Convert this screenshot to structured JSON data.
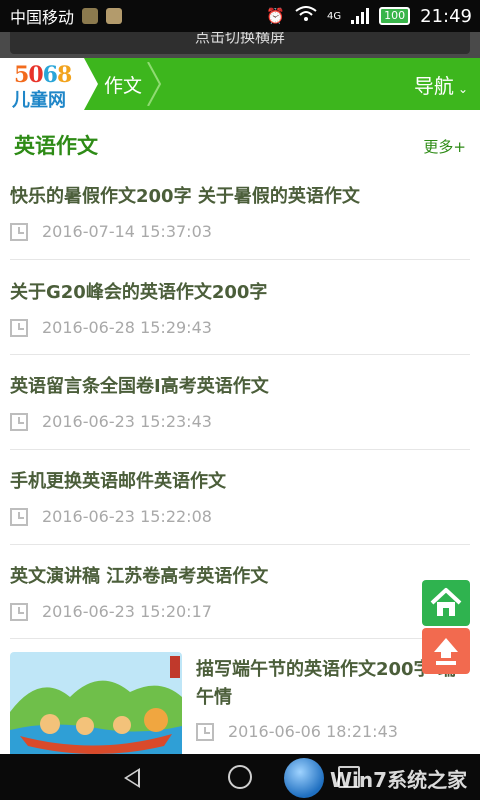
{
  "status_bar": {
    "carrier": "中国移动",
    "network": "4G",
    "battery": "100",
    "time": "21:49"
  },
  "banner": {
    "text": "点击切换横屏"
  },
  "header": {
    "logo_number": [
      "5",
      "0",
      "6",
      "8"
    ],
    "logo_text": "儿童网",
    "breadcrumb": "作文",
    "nav_label": "导航",
    "nav_caret": "⌄"
  },
  "section": {
    "title": "英语作文",
    "more": "更多+"
  },
  "articles": [
    {
      "title": "快乐的暑假作文200字 关于暑假的英语作文",
      "date": "2016-07-14 15:37:03"
    },
    {
      "title": "关于G20峰会的英语作文200字",
      "date": "2016-06-28 15:29:43"
    },
    {
      "title": "英语留言条全国卷I高考英语作文",
      "date": "2016-06-23 15:23:43"
    },
    {
      "title": "手机更换英语邮件英语作文",
      "date": "2016-06-23 15:22:08"
    },
    {
      "title": "英文演讲稿 江苏卷高考英语作文",
      "date": "2016-06-23 15:20:17"
    }
  ],
  "image_article": {
    "title": "描写端午节的英语作文200字 端午情",
    "date": "2016-06-06 18:21:43"
  },
  "watermark": {
    "text": "Win7系统之家"
  },
  "colors": {
    "brand_green": "#3db61d",
    "title_green": "#2e8b16",
    "home_button": "#2fb34f",
    "top_button": "#f26a4f"
  }
}
